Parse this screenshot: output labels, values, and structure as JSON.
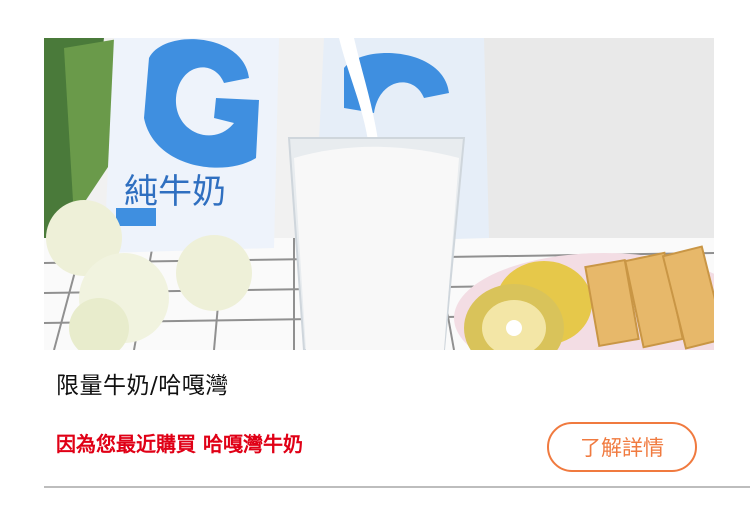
{
  "product": {
    "image_alt": "milk product photo",
    "title": "限量牛奶/哈嘎灣",
    "recommendation_reason": "因為您最近購買 哈嘎灣牛奶",
    "detail_button_label": "了解詳情",
    "package_text": "純牛奶"
  },
  "colors": {
    "reason_text": "#e00016",
    "button_accent": "#f07a3f",
    "divider": "#bdbdbd"
  }
}
